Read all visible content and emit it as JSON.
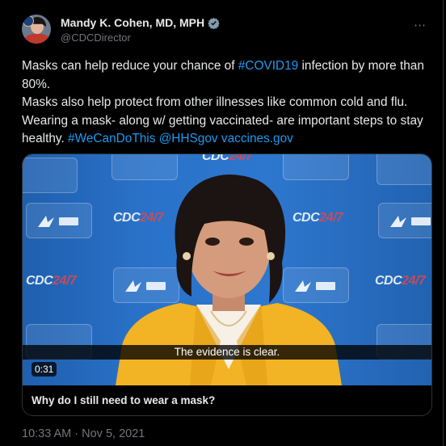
{
  "author": {
    "name": "Mandy K. Cohen, MD, MPH",
    "handle": "@CDCDirector"
  },
  "tweet": {
    "line1_pre": "Masks can help reduce your chance of ",
    "line1_hashtag": "#COVID19",
    "line1_post": " infection by more than 80%.",
    "line2": "Masks also help protect from other illnesses like common cold and flu.",
    "line3": "Wearing a mask- along w/ getting vaccinated- are important steps to stay healthy. ",
    "hashtag2": "#WeCanDoThis",
    "mention": "@HHSgov",
    "url": "vaccines.gov"
  },
  "media": {
    "caption": "The evidence is clear.",
    "duration": "0:31",
    "title": "Why do I still need to wear a mask?",
    "backdrop_logo_cdc": "CDC",
    "backdrop_logo_247": "24/7"
  },
  "meta": {
    "timestamp": "10:33 AM · Nov 5, 2021"
  },
  "more_icon": "⋯",
  "colors": {
    "background": "#000000",
    "text": "#e7e9ea",
    "link": "#1d9bf0",
    "secondary": "#71767b",
    "verified": "#829aab"
  }
}
